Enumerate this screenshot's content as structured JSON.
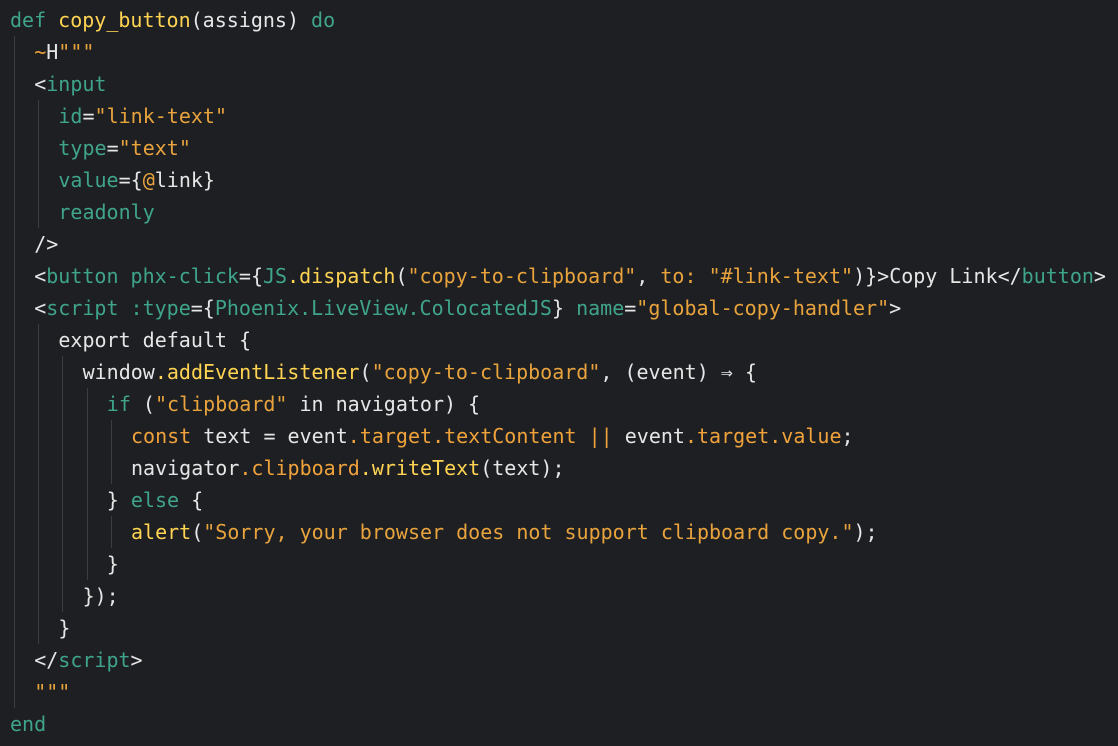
{
  "editor": {
    "language": "elixir-heex",
    "background": "#1d1f23",
    "lines": [
      {
        "indent": 0,
        "tokens": [
          {
            "t": "def ",
            "c": "kw"
          },
          {
            "t": "copy_button",
            "c": "fn"
          },
          {
            "t": "(assigns) ",
            "c": "plain"
          },
          {
            "t": "do",
            "c": "kw"
          }
        ]
      },
      {
        "indent": 1,
        "tokens": [
          {
            "t": "~",
            "c": "sig"
          },
          {
            "t": "H",
            "c": "plain"
          },
          {
            "t": "\"\"\"",
            "c": "str"
          }
        ]
      },
      {
        "indent": 1,
        "tokens": [
          {
            "t": "<",
            "c": "punct"
          },
          {
            "t": "input",
            "c": "tag"
          }
        ]
      },
      {
        "indent": 2,
        "tokens": [
          {
            "t": "id",
            "c": "attr"
          },
          {
            "t": "=",
            "c": "punct"
          },
          {
            "t": "\"link-text\"",
            "c": "str"
          }
        ]
      },
      {
        "indent": 2,
        "tokens": [
          {
            "t": "type",
            "c": "attr"
          },
          {
            "t": "=",
            "c": "punct"
          },
          {
            "t": "\"text\"",
            "c": "str"
          }
        ]
      },
      {
        "indent": 2,
        "tokens": [
          {
            "t": "value",
            "c": "attr"
          },
          {
            "t": "={",
            "c": "punct"
          },
          {
            "t": "@",
            "c": "at"
          },
          {
            "t": "link",
            "c": "plain"
          },
          {
            "t": "}",
            "c": "punct"
          }
        ]
      },
      {
        "indent": 2,
        "tokens": [
          {
            "t": "readonly",
            "c": "attr"
          }
        ]
      },
      {
        "indent": 1,
        "tokens": [
          {
            "t": "/>",
            "c": "punct"
          }
        ]
      },
      {
        "indent": 1,
        "tokens": [
          {
            "t": "<",
            "c": "punct"
          },
          {
            "t": "button",
            "c": "tag"
          },
          {
            "t": " phx-click",
            "c": "attr"
          },
          {
            "t": "={",
            "c": "punct"
          },
          {
            "t": "JS",
            "c": "mod"
          },
          {
            "t": ".dispatch",
            "c": "fn"
          },
          {
            "t": "(",
            "c": "punct"
          },
          {
            "t": "\"copy-to-clipboard\"",
            "c": "str"
          },
          {
            "t": ", ",
            "c": "punct"
          },
          {
            "t": "to:",
            "c": "str"
          },
          {
            "t": " ",
            "c": "plain"
          },
          {
            "t": "\"#link-text\"",
            "c": "str"
          },
          {
            "t": ")}>",
            "c": "punct"
          },
          {
            "t": "Copy Link",
            "c": "plain"
          },
          {
            "t": "</",
            "c": "punct"
          },
          {
            "t": "button",
            "c": "tag"
          },
          {
            "t": ">",
            "c": "punct"
          }
        ]
      },
      {
        "indent": 1,
        "tokens": [
          {
            "t": "<",
            "c": "punct"
          },
          {
            "t": "script",
            "c": "tag"
          },
          {
            "t": " :type",
            "c": "attr"
          },
          {
            "t": "={",
            "c": "punct"
          },
          {
            "t": "Phoenix.LiveView.ColocatedJS",
            "c": "mod"
          },
          {
            "t": "}",
            "c": "punct"
          },
          {
            "t": " name",
            "c": "attr"
          },
          {
            "t": "=",
            "c": "punct"
          },
          {
            "t": "\"global-copy-handler\"",
            "c": "str"
          },
          {
            "t": ">",
            "c": "punct"
          }
        ]
      },
      {
        "indent": 2,
        "tokens": [
          {
            "t": "export default {",
            "c": "plain"
          }
        ]
      },
      {
        "indent": 3,
        "tokens": [
          {
            "t": "window",
            "c": "plain"
          },
          {
            "t": ".addEventListener",
            "c": "fn"
          },
          {
            "t": "(",
            "c": "punct"
          },
          {
            "t": "\"copy-to-clipboard\"",
            "c": "str"
          },
          {
            "t": ", (event) ⇒ {",
            "c": "plain"
          }
        ]
      },
      {
        "indent": 4,
        "tokens": [
          {
            "t": "if",
            "c": "kw"
          },
          {
            "t": " (",
            "c": "plain"
          },
          {
            "t": "\"clipboard\"",
            "c": "str"
          },
          {
            "t": " in ",
            "c": "plain"
          },
          {
            "t": "navigator) {",
            "c": "plain"
          }
        ]
      },
      {
        "indent": 5,
        "tokens": [
          {
            "t": "const",
            "c": "kwy"
          },
          {
            "t": " text = event",
            "c": "plain"
          },
          {
            "t": ".target",
            "c": "prop"
          },
          {
            "t": ".textContent",
            "c": "prop"
          },
          {
            "t": " || ",
            "c": "op"
          },
          {
            "t": "event",
            "c": "plain"
          },
          {
            "t": ".target",
            "c": "prop"
          },
          {
            "t": ".value",
            "c": "prop"
          },
          {
            "t": ";",
            "c": "plain"
          }
        ]
      },
      {
        "indent": 5,
        "tokens": [
          {
            "t": "navigator",
            "c": "plain"
          },
          {
            "t": ".clipboard",
            "c": "prop"
          },
          {
            "t": ".writeText",
            "c": "fn"
          },
          {
            "t": "(text);",
            "c": "plain"
          }
        ]
      },
      {
        "indent": 4,
        "tokens": [
          {
            "t": "} ",
            "c": "plain"
          },
          {
            "t": "else",
            "c": "kw"
          },
          {
            "t": " {",
            "c": "plain"
          }
        ]
      },
      {
        "indent": 5,
        "tokens": [
          {
            "t": "alert",
            "c": "fn"
          },
          {
            "t": "(",
            "c": "plain"
          },
          {
            "t": "\"Sorry, your browser does not support clipboard copy.\"",
            "c": "str"
          },
          {
            "t": ");",
            "c": "plain"
          }
        ]
      },
      {
        "indent": 4,
        "tokens": [
          {
            "t": "}",
            "c": "plain"
          }
        ]
      },
      {
        "indent": 3,
        "tokens": [
          {
            "t": "});",
            "c": "plain"
          }
        ]
      },
      {
        "indent": 2,
        "tokens": [
          {
            "t": "}",
            "c": "plain"
          }
        ]
      },
      {
        "indent": 1,
        "tokens": [
          {
            "t": "</",
            "c": "punct"
          },
          {
            "t": "script",
            "c": "tag"
          },
          {
            "t": ">",
            "c": "punct"
          }
        ]
      },
      {
        "indent": 1,
        "tokens": [
          {
            "t": "\"\"\"",
            "c": "str"
          }
        ]
      },
      {
        "indent": 0,
        "tokens": [
          {
            "t": "end",
            "c": "kw"
          }
        ]
      }
    ]
  }
}
